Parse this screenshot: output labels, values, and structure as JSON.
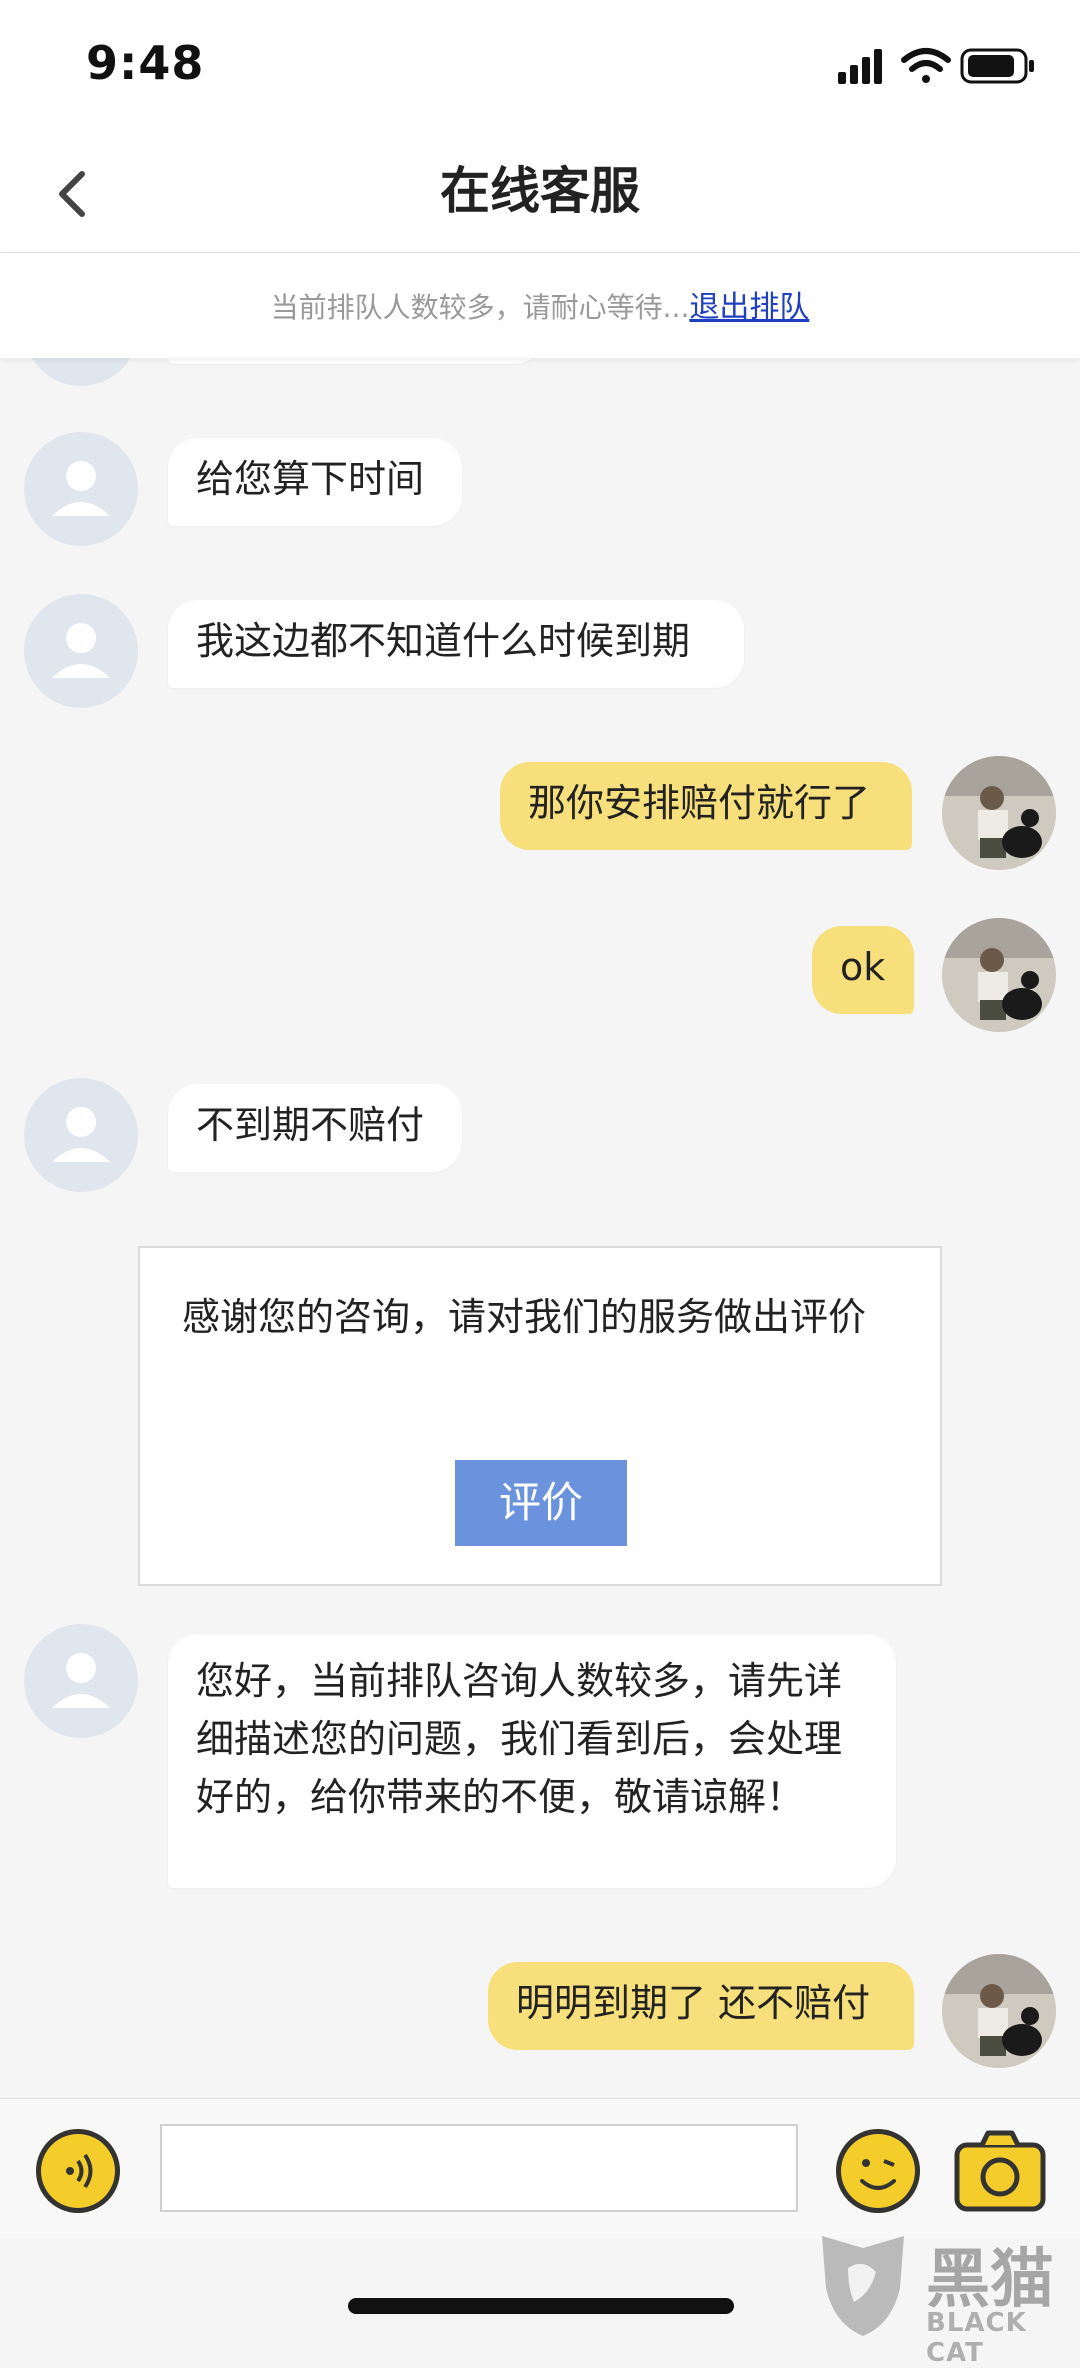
{
  "status_bar": {
    "time": "9:48"
  },
  "header": {
    "title": "在线客服"
  },
  "queue": {
    "message": "当前排队人数较多，请耐心等待...",
    "exit_link": "退出排队"
  },
  "messages": [
    {
      "from": "agent",
      "text": "给您算下时间"
    },
    {
      "from": "agent",
      "text": "我这边都不知道什么时候到期"
    },
    {
      "from": "user",
      "text": "那你安排赔付就行了"
    },
    {
      "from": "user",
      "text": "ok"
    },
    {
      "from": "agent",
      "text": "不到期不赔付"
    },
    {
      "from": "agent",
      "text": "您好，当前排队咨询人数较多，请先详细描述您的问题，我们看到后，会处理好的，给你带来的不便，敬请谅解！"
    },
    {
      "from": "user",
      "text": "明明到期了 还不赔付"
    }
  ],
  "rating": {
    "prompt": "感谢您的咨询，请对我们的服务做出评价",
    "button": "评价"
  },
  "input": {
    "placeholder": "",
    "value": ""
  },
  "watermark": {
    "zh": "黑猫",
    "en": "BLACK CAT"
  },
  "colors": {
    "user_bubble": "#f7df7b",
    "agent_bubble": "#ffffff",
    "rating_button": "#6b92dd",
    "accent_yellow": "#f5cd2b",
    "link": "#1e3fbf"
  },
  "icons": [
    "back-chevron-icon",
    "signal-icon",
    "wifi-icon",
    "battery-icon",
    "default-avatar-icon",
    "voice-icon",
    "emoji-icon",
    "camera-icon"
  ]
}
